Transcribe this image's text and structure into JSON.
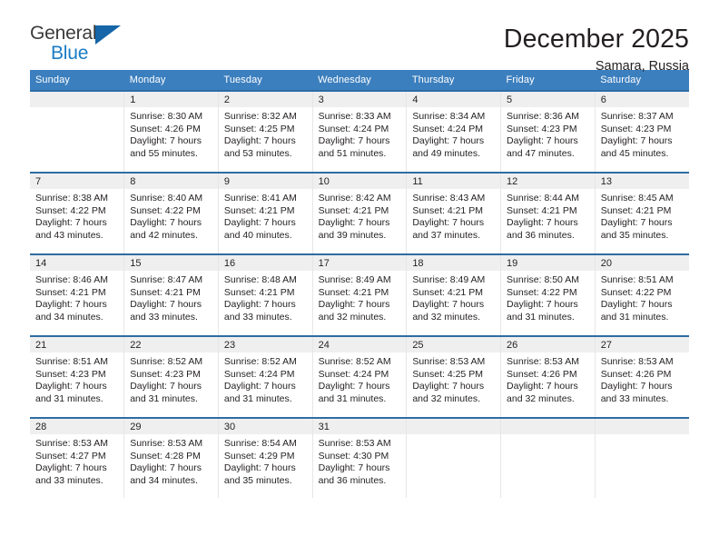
{
  "brand": {
    "name_part1": "General",
    "name_part2": "Blue",
    "triangle_icon": "brand-triangle-icon"
  },
  "header": {
    "title": "December 2025",
    "subtitle": "Samara, Russia"
  },
  "calendar": {
    "weekday_headers": [
      "Sunday",
      "Monday",
      "Tuesday",
      "Wednesday",
      "Thursday",
      "Friday",
      "Saturday"
    ],
    "colors": {
      "header_background": "#3c7fbe",
      "row_top_border": "#2e6da4",
      "daynum_band": "#efefef",
      "brand_blue": "#1b7cc4",
      "text": "#231f20"
    },
    "weeks": [
      [
        {
          "day": "",
          "sunrise": "",
          "sunset": "",
          "daylight_line1": "",
          "daylight_line2": "",
          "empty": true
        },
        {
          "day": "1",
          "sunrise": "Sunrise: 8:30 AM",
          "sunset": "Sunset: 4:26 PM",
          "daylight_line1": "Daylight: 7 hours",
          "daylight_line2": "and 55 minutes."
        },
        {
          "day": "2",
          "sunrise": "Sunrise: 8:32 AM",
          "sunset": "Sunset: 4:25 PM",
          "daylight_line1": "Daylight: 7 hours",
          "daylight_line2": "and 53 minutes."
        },
        {
          "day": "3",
          "sunrise": "Sunrise: 8:33 AM",
          "sunset": "Sunset: 4:24 PM",
          "daylight_line1": "Daylight: 7 hours",
          "daylight_line2": "and 51 minutes."
        },
        {
          "day": "4",
          "sunrise": "Sunrise: 8:34 AM",
          "sunset": "Sunset: 4:24 PM",
          "daylight_line1": "Daylight: 7 hours",
          "daylight_line2": "and 49 minutes."
        },
        {
          "day": "5",
          "sunrise": "Sunrise: 8:36 AM",
          "sunset": "Sunset: 4:23 PM",
          "daylight_line1": "Daylight: 7 hours",
          "daylight_line2": "and 47 minutes."
        },
        {
          "day": "6",
          "sunrise": "Sunrise: 8:37 AM",
          "sunset": "Sunset: 4:23 PM",
          "daylight_line1": "Daylight: 7 hours",
          "daylight_line2": "and 45 minutes."
        }
      ],
      [
        {
          "day": "7",
          "sunrise": "Sunrise: 8:38 AM",
          "sunset": "Sunset: 4:22 PM",
          "daylight_line1": "Daylight: 7 hours",
          "daylight_line2": "and 43 minutes."
        },
        {
          "day": "8",
          "sunrise": "Sunrise: 8:40 AM",
          "sunset": "Sunset: 4:22 PM",
          "daylight_line1": "Daylight: 7 hours",
          "daylight_line2": "and 42 minutes."
        },
        {
          "day": "9",
          "sunrise": "Sunrise: 8:41 AM",
          "sunset": "Sunset: 4:21 PM",
          "daylight_line1": "Daylight: 7 hours",
          "daylight_line2": "and 40 minutes."
        },
        {
          "day": "10",
          "sunrise": "Sunrise: 8:42 AM",
          "sunset": "Sunset: 4:21 PM",
          "daylight_line1": "Daylight: 7 hours",
          "daylight_line2": "and 39 minutes."
        },
        {
          "day": "11",
          "sunrise": "Sunrise: 8:43 AM",
          "sunset": "Sunset: 4:21 PM",
          "daylight_line1": "Daylight: 7 hours",
          "daylight_line2": "and 37 minutes."
        },
        {
          "day": "12",
          "sunrise": "Sunrise: 8:44 AM",
          "sunset": "Sunset: 4:21 PM",
          "daylight_line1": "Daylight: 7 hours",
          "daylight_line2": "and 36 minutes."
        },
        {
          "day": "13",
          "sunrise": "Sunrise: 8:45 AM",
          "sunset": "Sunset: 4:21 PM",
          "daylight_line1": "Daylight: 7 hours",
          "daylight_line2": "and 35 minutes."
        }
      ],
      [
        {
          "day": "14",
          "sunrise": "Sunrise: 8:46 AM",
          "sunset": "Sunset: 4:21 PM",
          "daylight_line1": "Daylight: 7 hours",
          "daylight_line2": "and 34 minutes."
        },
        {
          "day": "15",
          "sunrise": "Sunrise: 8:47 AM",
          "sunset": "Sunset: 4:21 PM",
          "daylight_line1": "Daylight: 7 hours",
          "daylight_line2": "and 33 minutes."
        },
        {
          "day": "16",
          "sunrise": "Sunrise: 8:48 AM",
          "sunset": "Sunset: 4:21 PM",
          "daylight_line1": "Daylight: 7 hours",
          "daylight_line2": "and 33 minutes."
        },
        {
          "day": "17",
          "sunrise": "Sunrise: 8:49 AM",
          "sunset": "Sunset: 4:21 PM",
          "daylight_line1": "Daylight: 7 hours",
          "daylight_line2": "and 32 minutes."
        },
        {
          "day": "18",
          "sunrise": "Sunrise: 8:49 AM",
          "sunset": "Sunset: 4:21 PM",
          "daylight_line1": "Daylight: 7 hours",
          "daylight_line2": "and 32 minutes."
        },
        {
          "day": "19",
          "sunrise": "Sunrise: 8:50 AM",
          "sunset": "Sunset: 4:22 PM",
          "daylight_line1": "Daylight: 7 hours",
          "daylight_line2": "and 31 minutes."
        },
        {
          "day": "20",
          "sunrise": "Sunrise: 8:51 AM",
          "sunset": "Sunset: 4:22 PM",
          "daylight_line1": "Daylight: 7 hours",
          "daylight_line2": "and 31 minutes."
        }
      ],
      [
        {
          "day": "21",
          "sunrise": "Sunrise: 8:51 AM",
          "sunset": "Sunset: 4:23 PM",
          "daylight_line1": "Daylight: 7 hours",
          "daylight_line2": "and 31 minutes."
        },
        {
          "day": "22",
          "sunrise": "Sunrise: 8:52 AM",
          "sunset": "Sunset: 4:23 PM",
          "daylight_line1": "Daylight: 7 hours",
          "daylight_line2": "and 31 minutes."
        },
        {
          "day": "23",
          "sunrise": "Sunrise: 8:52 AM",
          "sunset": "Sunset: 4:24 PM",
          "daylight_line1": "Daylight: 7 hours",
          "daylight_line2": "and 31 minutes."
        },
        {
          "day": "24",
          "sunrise": "Sunrise: 8:52 AM",
          "sunset": "Sunset: 4:24 PM",
          "daylight_line1": "Daylight: 7 hours",
          "daylight_line2": "and 31 minutes."
        },
        {
          "day": "25",
          "sunrise": "Sunrise: 8:53 AM",
          "sunset": "Sunset: 4:25 PM",
          "daylight_line1": "Daylight: 7 hours",
          "daylight_line2": "and 32 minutes."
        },
        {
          "day": "26",
          "sunrise": "Sunrise: 8:53 AM",
          "sunset": "Sunset: 4:26 PM",
          "daylight_line1": "Daylight: 7 hours",
          "daylight_line2": "and 32 minutes."
        },
        {
          "day": "27",
          "sunrise": "Sunrise: 8:53 AM",
          "sunset": "Sunset: 4:26 PM",
          "daylight_line1": "Daylight: 7 hours",
          "daylight_line2": "and 33 minutes."
        }
      ],
      [
        {
          "day": "28",
          "sunrise": "Sunrise: 8:53 AM",
          "sunset": "Sunset: 4:27 PM",
          "daylight_line1": "Daylight: 7 hours",
          "daylight_line2": "and 33 minutes."
        },
        {
          "day": "29",
          "sunrise": "Sunrise: 8:53 AM",
          "sunset": "Sunset: 4:28 PM",
          "daylight_line1": "Daylight: 7 hours",
          "daylight_line2": "and 34 minutes."
        },
        {
          "day": "30",
          "sunrise": "Sunrise: 8:54 AM",
          "sunset": "Sunset: 4:29 PM",
          "daylight_line1": "Daylight: 7 hours",
          "daylight_line2": "and 35 minutes."
        },
        {
          "day": "31",
          "sunrise": "Sunrise: 8:53 AM",
          "sunset": "Sunset: 4:30 PM",
          "daylight_line1": "Daylight: 7 hours",
          "daylight_line2": "and 36 minutes."
        },
        {
          "day": "",
          "sunrise": "",
          "sunset": "",
          "daylight_line1": "",
          "daylight_line2": "",
          "empty": true
        },
        {
          "day": "",
          "sunrise": "",
          "sunset": "",
          "daylight_line1": "",
          "daylight_line2": "",
          "empty": true
        },
        {
          "day": "",
          "sunrise": "",
          "sunset": "",
          "daylight_line1": "",
          "daylight_line2": "",
          "empty": true
        }
      ]
    ]
  }
}
